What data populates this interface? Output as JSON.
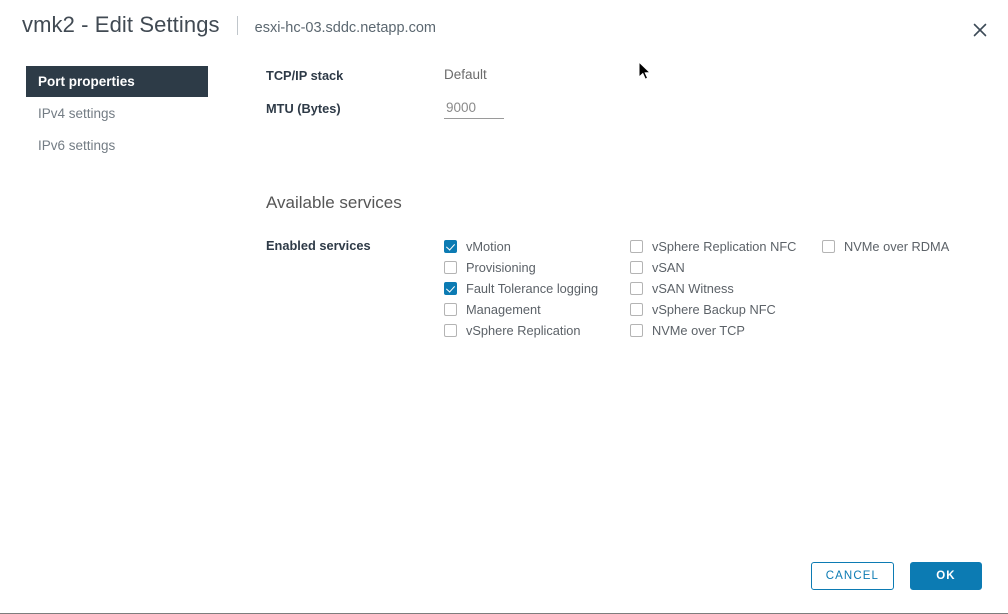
{
  "header": {
    "title": "vmk2 - Edit Settings",
    "subtitle": "esxi-hc-03.sddc.netapp.com",
    "close_icon": "close-icon"
  },
  "sidebar": {
    "items": [
      {
        "label": "Port properties",
        "active": true
      },
      {
        "label": "IPv4 settings",
        "active": false
      },
      {
        "label": "IPv6 settings",
        "active": false
      }
    ]
  },
  "main": {
    "fields": [
      {
        "label": "TCP/IP stack",
        "value": "Default",
        "type": "text"
      },
      {
        "label": "MTU (Bytes)",
        "value": "9000",
        "type": "input"
      }
    ],
    "section_title": "Available services",
    "services_label": "Enabled services",
    "service_columns": [
      [
        {
          "label": "vMotion",
          "checked": true
        },
        {
          "label": "Provisioning",
          "checked": false
        },
        {
          "label": "Fault Tolerance logging",
          "checked": true
        },
        {
          "label": "Management",
          "checked": false
        },
        {
          "label": "vSphere Replication",
          "checked": false
        }
      ],
      [
        {
          "label": "vSphere Replication NFC",
          "checked": false
        },
        {
          "label": "vSAN",
          "checked": false
        },
        {
          "label": "vSAN Witness",
          "checked": false
        },
        {
          "label": "vSphere Backup NFC",
          "checked": false
        },
        {
          "label": "NVMe over TCP",
          "checked": false
        }
      ],
      [
        {
          "label": "NVMe over RDMA",
          "checked": false
        }
      ]
    ]
  },
  "footer": {
    "cancel_label": "CANCEL",
    "ok_label": "OK"
  },
  "colors": {
    "accent": "#0c7bb3",
    "sidebar_active_bg": "#2d3b47",
    "label_text": "#2e3a47",
    "body_text": "#5c6268"
  }
}
